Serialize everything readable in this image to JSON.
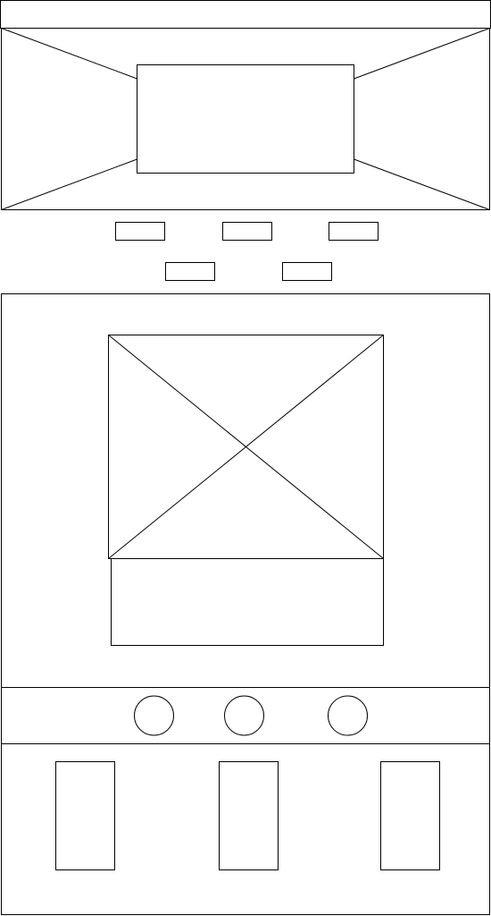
{
  "wireframe": {
    "stroke_color": "#000000",
    "background_color": "#ffffff",
    "header": {
      "type": "bar",
      "text": ""
    },
    "hero_banner": {
      "type": "image-placeholder",
      "inner_block": {
        "type": "text-placeholder"
      }
    },
    "nav_buttons": {
      "row_1_count": 3,
      "row_2_count": 2
    },
    "content_card": {
      "image": {
        "type": "image-placeholder"
      },
      "caption": {
        "type": "text-placeholder"
      }
    },
    "pagination_dots": {
      "count": 3
    },
    "footer_cards": {
      "count": 3
    }
  }
}
